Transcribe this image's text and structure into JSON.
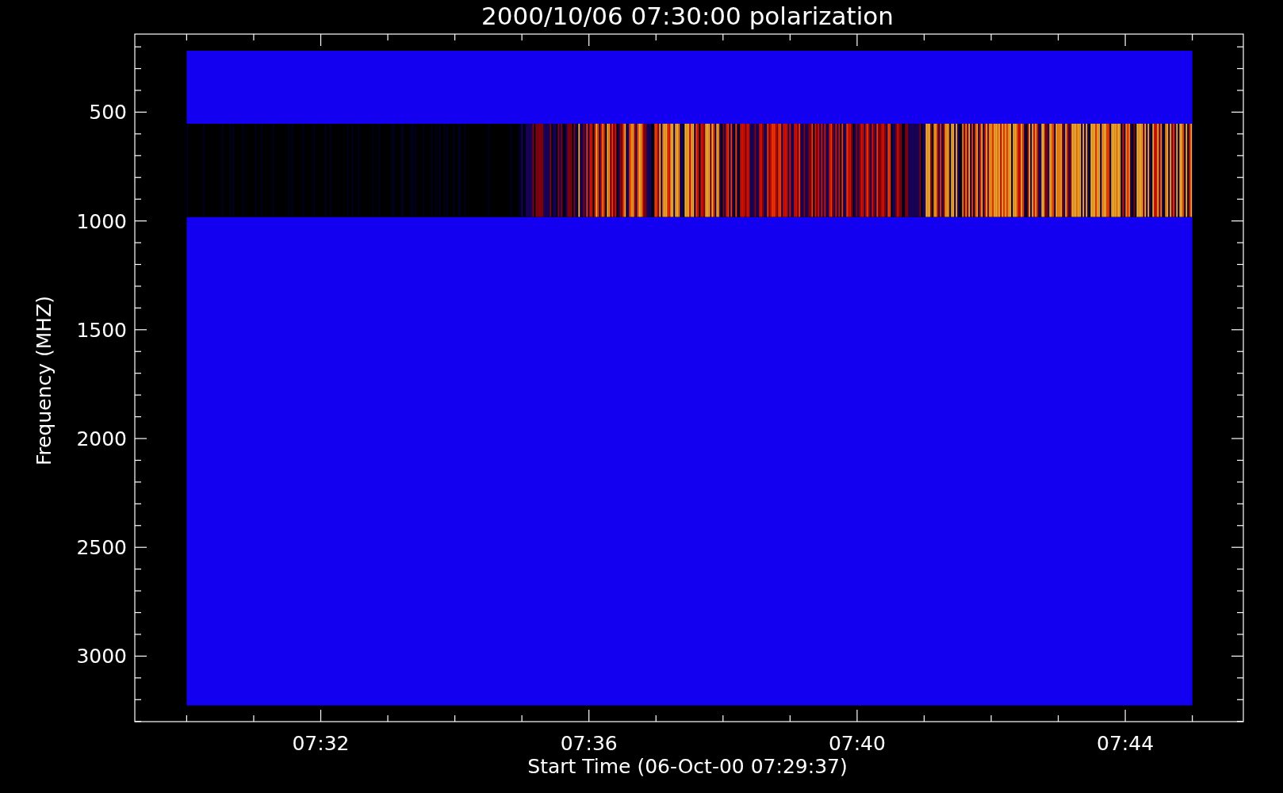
{
  "title": "2000/10/06 07:30:00 polarization",
  "ylabel": "Frequency (MHZ)",
  "xlabel": "Start Time (06-Oct-00 07:29:37)",
  "ytick_labels": [
    "500",
    "1000",
    "1500",
    "2000",
    "2500",
    "3000"
  ],
  "xtick_labels": [
    "07:32",
    "07:36",
    "07:40",
    "07:44"
  ]
}
